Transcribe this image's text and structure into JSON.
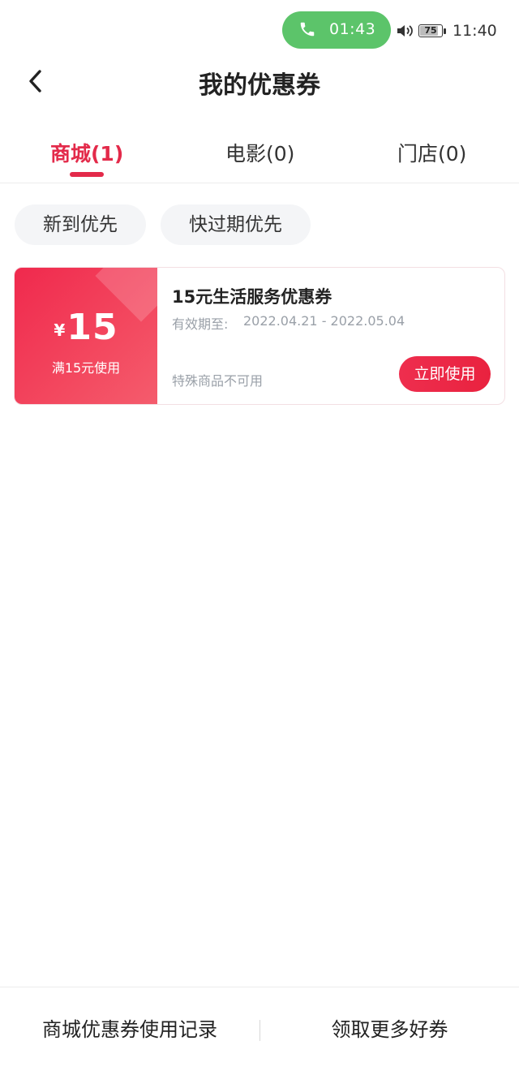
{
  "status_bar": {
    "call_time": "01:43",
    "battery_level": "75",
    "clock": "11:40",
    "call_color": "#5cc46a"
  },
  "header": {
    "title": "我的优惠券",
    "back_icon": "chevron-left-icon"
  },
  "tabs": [
    {
      "label": "商城(1)",
      "active": true
    },
    {
      "label": "电影(0)",
      "active": false
    },
    {
      "label": "门店(0)",
      "active": false
    }
  ],
  "filters": [
    {
      "label": "新到优先"
    },
    {
      "label": "快过期优先"
    }
  ],
  "coupon": {
    "currency": "¥",
    "amount": "15",
    "threshold": "满15元使用",
    "title": "15元生活服务优惠券",
    "validity_label": "有效期至:",
    "validity_value": "2022.04.21 - 2022.05.04",
    "restriction": "特殊商品不可用",
    "use_button": "立即使用"
  },
  "bottom_bar": {
    "history": "商城优惠券使用记录",
    "get_more": "领取更多好券"
  },
  "colors": {
    "accent": "#e32a4a",
    "muted_text": "#9aa0a8"
  }
}
